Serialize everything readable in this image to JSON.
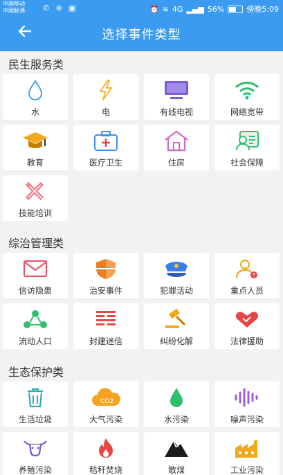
{
  "status": {
    "carrier1": "中国移动",
    "carrier2": "中国联通",
    "battery": "56%",
    "time": "傍晚5:09",
    "network": "4G"
  },
  "appbar": {
    "title": "选择事件类型"
  },
  "sections": [
    {
      "title": "民生服务类",
      "items": [
        {
          "label": "水",
          "icon": "water-drop-icon"
        },
        {
          "label": "电",
          "icon": "lightning-icon"
        },
        {
          "label": "有线电视",
          "icon": "tv-icon"
        },
        {
          "label": "网络宽带",
          "icon": "wifi-icon"
        },
        {
          "label": "教育",
          "icon": "graduation-cap-icon"
        },
        {
          "label": "医疗卫生",
          "icon": "first-aid-kit-icon"
        },
        {
          "label": "住房",
          "icon": "house-icon"
        },
        {
          "label": "社会保障",
          "icon": "id-card-icon"
        },
        {
          "label": "技能培训",
          "icon": "tools-icon"
        }
      ]
    },
    {
      "title": "综治管理类",
      "items": [
        {
          "label": "信访隐患",
          "icon": "envelope-icon"
        },
        {
          "label": "治安事件",
          "icon": "shield-icon"
        },
        {
          "label": "犯罪活动",
          "icon": "police-cap-icon"
        },
        {
          "label": "重点人员",
          "icon": "person-alert-icon"
        },
        {
          "label": "流动人口",
          "icon": "people-network-icon"
        },
        {
          "label": "封建迷信",
          "icon": "hexagram-icon"
        },
        {
          "label": "纠纷化解",
          "icon": "gavel-icon"
        },
        {
          "label": "法律援助",
          "icon": "handshake-icon"
        }
      ]
    },
    {
      "title": "生态保护类",
      "items": [
        {
          "label": "生活垃圾",
          "icon": "trash-can-icon"
        },
        {
          "label": "大气污染",
          "icon": "co2-cloud-icon"
        },
        {
          "label": "水污染",
          "icon": "green-drop-icon"
        },
        {
          "label": "噪声污染",
          "icon": "sound-wave-icon"
        },
        {
          "label": "养殖污染",
          "icon": "ox-head-icon"
        },
        {
          "label": "秸秆焚烧",
          "icon": "fire-icon"
        },
        {
          "label": "散煤",
          "icon": "coal-pile-icon"
        },
        {
          "label": "工业污染",
          "icon": "factory-icon"
        }
      ]
    }
  ]
}
